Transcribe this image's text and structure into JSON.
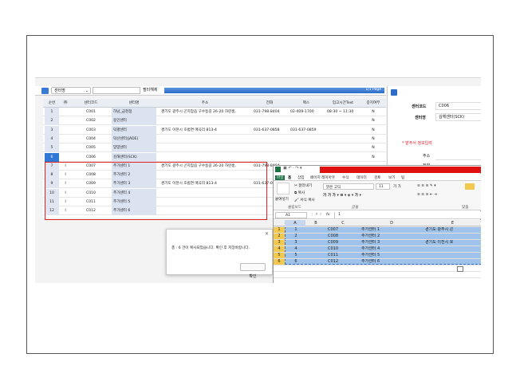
{
  "toolbar": {
    "dropdown_value": "센터명",
    "filter_label": "필터해제",
    "page_indicator": "1/1 Page"
  },
  "grid": {
    "headers": [
      "순번",
      "㈜",
      "센터코드",
      "센터명",
      "주소",
      "전화",
      "팩스",
      "입고시간Text",
      "중지여부"
    ],
    "rows": [
      {
        "no": "1",
        "flag": "",
        "code": "C001",
        "name": "하남_금천점",
        "addr": "경기도 광주시 곤지암읍 구수동길 26-20 하란홈,",
        "tel": "031-798-8404",
        "fax": "02-409-1700",
        "time": "08:30 ~ 11:30",
        "stop": "N"
      },
      {
        "no": "2",
        "flag": "",
        "code": "C002",
        "name": "용인센터",
        "addr": "",
        "tel": "",
        "fax": "",
        "time": "",
        "stop": "N"
      },
      {
        "no": "3",
        "flag": "",
        "code": "C003",
        "name": "덕평센터",
        "addr": "경기도 이천시 호법면 매곡리 813-4",
        "tel": "031-637-0858",
        "fax": "031-637-0859",
        "time": "",
        "stop": "N"
      },
      {
        "no": "4",
        "flag": "",
        "code": "C004",
        "name": "덕산센터(JADE)",
        "addr": "",
        "tel": "",
        "fax": "",
        "time": "",
        "stop": "N"
      },
      {
        "no": "5",
        "flag": "",
        "code": "C005",
        "name": "양양센터",
        "addr": "",
        "tel": "",
        "fax": "",
        "time": "",
        "stop": "N"
      },
      {
        "no": "6",
        "flag": "",
        "code": "C006",
        "name": "김해센터(SCK)",
        "addr": "",
        "tel": "",
        "fax": "",
        "time": "",
        "stop": "N"
      },
      {
        "no": "7",
        "flag": "I",
        "code": "C007",
        "name": "추가센터 1",
        "addr": "경기도 광주시 곤지암읍 구수동길 26-20 하란홈,",
        "tel": "031-798-8404",
        "fax": "",
        "time": "",
        "stop": ""
      },
      {
        "no": "8",
        "flag": "I",
        "code": "C008",
        "name": "추가센터 2",
        "addr": "",
        "tel": "",
        "fax": "",
        "time": "",
        "stop": ""
      },
      {
        "no": "9",
        "flag": "I",
        "code": "C009",
        "name": "추가센터 3",
        "addr": "경기도 이천시 호법면 매곡리 813-4",
        "tel": "031-637-0858",
        "fax": "",
        "time": "",
        "stop": ""
      },
      {
        "no": "10",
        "flag": "I",
        "code": "C010",
        "name": "추가센터 4",
        "addr": "",
        "tel": "",
        "fax": "",
        "time": "",
        "stop": ""
      },
      {
        "no": "11",
        "flag": "I",
        "code": "C011",
        "name": "추가센터 5",
        "addr": "",
        "tel": "",
        "fax": "",
        "time": "",
        "stop": ""
      },
      {
        "no": "12",
        "flag": "I",
        "code": "C012",
        "name": "추가센터 6",
        "addr": "",
        "tel": "",
        "fax": "",
        "time": "",
        "stop": ""
      }
    ]
  },
  "detail": {
    "code_label": "센터코드",
    "code_value": "C006",
    "name_label": "센터명",
    "name_value": "김해센터(SCK)",
    "section_title": "* 발주서 정보입력",
    "addr_label": "주소",
    "tel_label": "전화"
  },
  "dialog": {
    "message": "총 : 6 건이 복사되었습니다. 확인 후 저장바랍니다.",
    "ok_label": "확인",
    "close_glyph": "✕"
  },
  "excel": {
    "tabs": [
      "파일",
      "홈",
      "삽입",
      "페이지 레이아웃",
      "수식",
      "데이터",
      "검토",
      "보기",
      "팁"
    ],
    "paste_label": "붙여넣기",
    "cut_label": "잘라내기",
    "copy_label": "복사",
    "format_painter_label": "서식 복사",
    "font_name": "맑은 고딕",
    "font_size": "11",
    "group_clipboard": "클립보드",
    "group_font": "글꼴",
    "group_align": "맞춤",
    "name_box": "A1",
    "formula_value": "1",
    "fx": "fx",
    "columns": [
      "A",
      "B",
      "C",
      "D",
      "E"
    ],
    "rows": [
      {
        "r": "1",
        "a": "1",
        "c": "C007",
        "d": "추가센터 1",
        "e": "경기도 광주시 곤"
      },
      {
        "r": "2",
        "a": "2",
        "c": "C008",
        "d": "추가센터 2",
        "e": ""
      },
      {
        "r": "3",
        "a": "3",
        "c": "C009",
        "d": "추가센터 3",
        "e": "경기도 이천시 호"
      },
      {
        "r": "4",
        "a": "4",
        "c": "C010",
        "d": "추가센터 4",
        "e": ""
      },
      {
        "r": "5",
        "a": "5",
        "c": "C011",
        "d": "추가센터 5",
        "e": ""
      },
      {
        "r": "6",
        "a": "6",
        "c": "C012",
        "d": "추가센터 6",
        "e": ""
      }
    ]
  }
}
